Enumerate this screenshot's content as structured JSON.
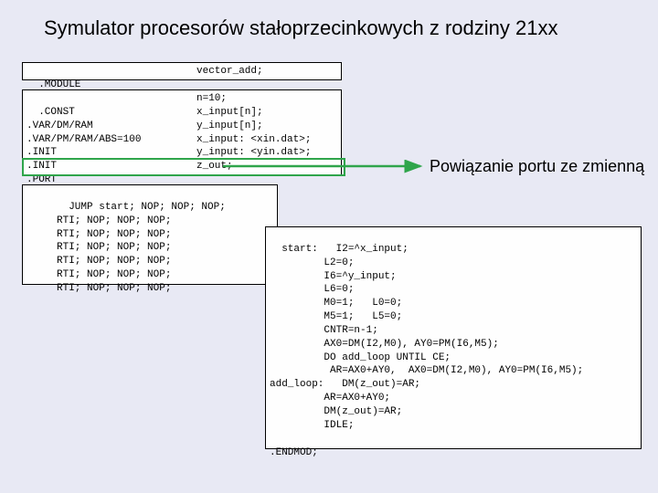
{
  "title": "Symulator procesorów stałoprzecinkowych z rodziny 21xx",
  "box1": {
    "col1": ".MODULE",
    "col2": "vector_add;"
  },
  "box2": {
    "col1": ".CONST\n.VAR/DM/RAM\n.VAR/PM/RAM/ABS=100\n.INIT\n.INIT\n.PORT",
    "col2": "n=10;\nx_input[n];\ny_input[n];\nx_input: <xin.dat>;\ny_input: <yin.dat>;\nz_out;"
  },
  "box3": {
    "text": "     JUMP start; NOP; NOP; NOP;\n     RTI; NOP; NOP; NOP;\n     RTI; NOP; NOP; NOP;\n     RTI; NOP; NOP; NOP;\n     RTI; NOP; NOP; NOP;\n     RTI; NOP; NOP; NOP;\n     RTI; NOP; NOP; NOP;"
  },
  "box4": {
    "text": "start:   I2=^x_input;\n         L2=0;\n         I6=^y_input;\n         L6=0;\n         M0=1;   L0=0;\n         M5=1;   L5=0;\n         CNTR=n-1;\n         AX0=DM(I2,M0), AY0=PM(I6,M5);\n         DO add_loop UNTIL CE;\n          AR=AX0+AY0,  AX0=DM(I2,M0), AY0=PM(I6,M5);\nadd_loop:   DM(z_out)=AR;\n         AR=AX0+AY0;\n         DM(z_out)=AR;\n         IDLE;\n\n.ENDMOD;"
  },
  "callout": "Powiązanie portu ze zmienną"
}
